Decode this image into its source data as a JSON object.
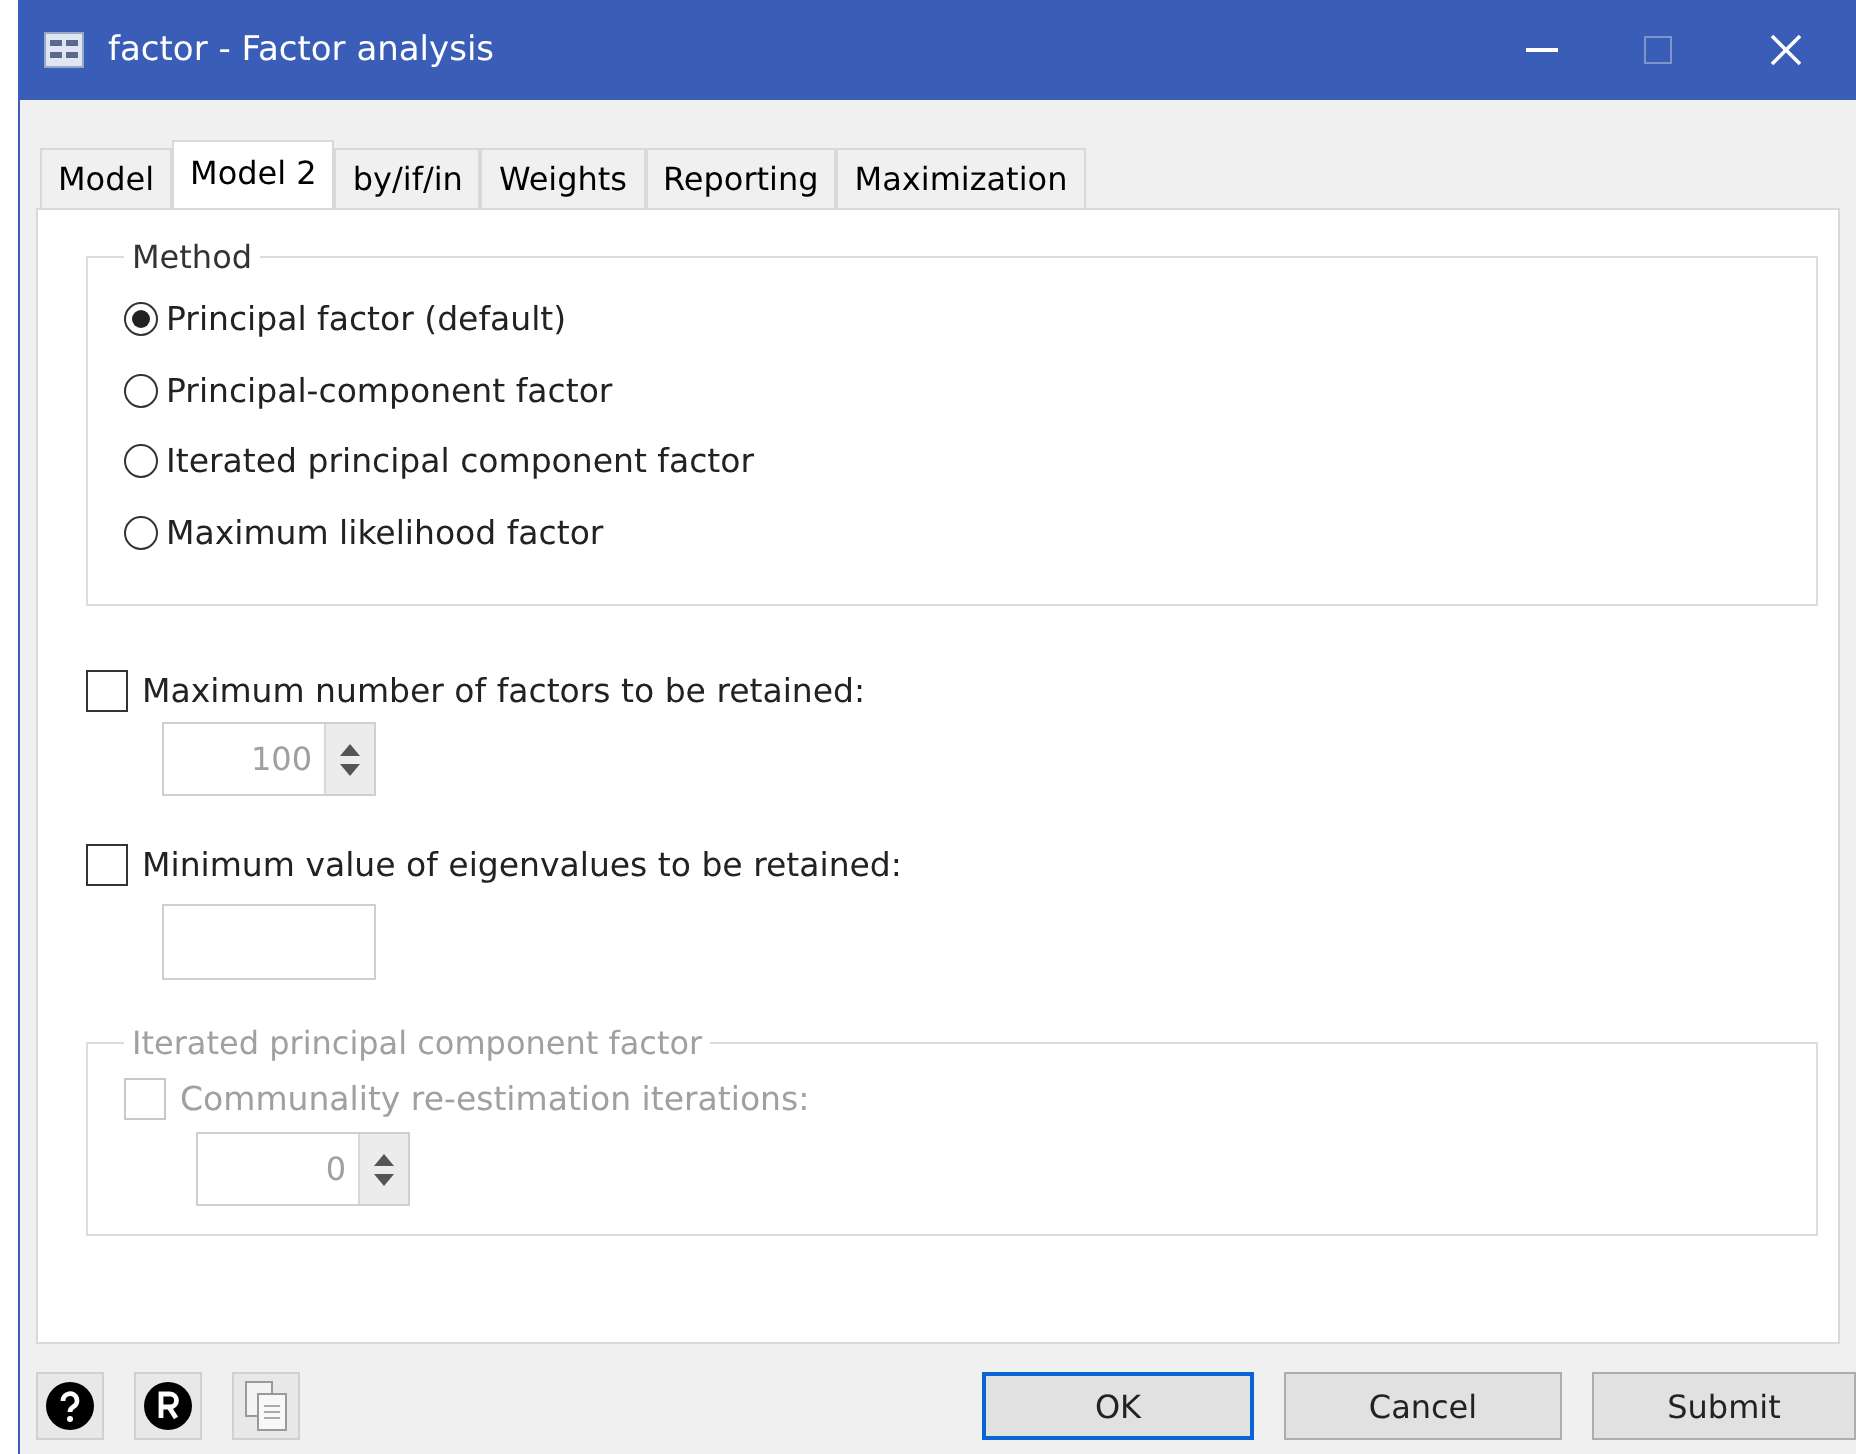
{
  "window": {
    "title": "factor - Factor analysis"
  },
  "tabs": [
    {
      "label": "Model",
      "selected": false
    },
    {
      "label": "Model 2",
      "selected": true
    },
    {
      "label": "by/if/in",
      "selected": false
    },
    {
      "label": "Weights",
      "selected": false
    },
    {
      "label": "Reporting",
      "selected": false
    },
    {
      "label": "Maximization",
      "selected": false
    }
  ],
  "method": {
    "title": "Method",
    "options": [
      {
        "label": "Principal factor (default)",
        "selected": true
      },
      {
        "label": "Principal-component factor",
        "selected": false
      },
      {
        "label": "Iterated principal component factor",
        "selected": false
      },
      {
        "label": "Maximum likelihood factor",
        "selected": false
      }
    ]
  },
  "max_factors": {
    "label": "Maximum number of factors to be retained:",
    "checked": false,
    "value": "100",
    "disabled": true
  },
  "min_eigenvalue": {
    "label": "Minimum value of eigenvalues to be retained:",
    "checked": false
  },
  "iterated": {
    "title": "Iterated principal component factor",
    "disabled": true,
    "checkbox": {
      "label": "Communality re-estimation iterations:",
      "checked": false
    },
    "value": "0"
  },
  "buttons": [
    {
      "label": "OK",
      "default": true
    },
    {
      "label": "Cancel",
      "default": false
    },
    {
      "label": "Submit",
      "default": false
    }
  ]
}
